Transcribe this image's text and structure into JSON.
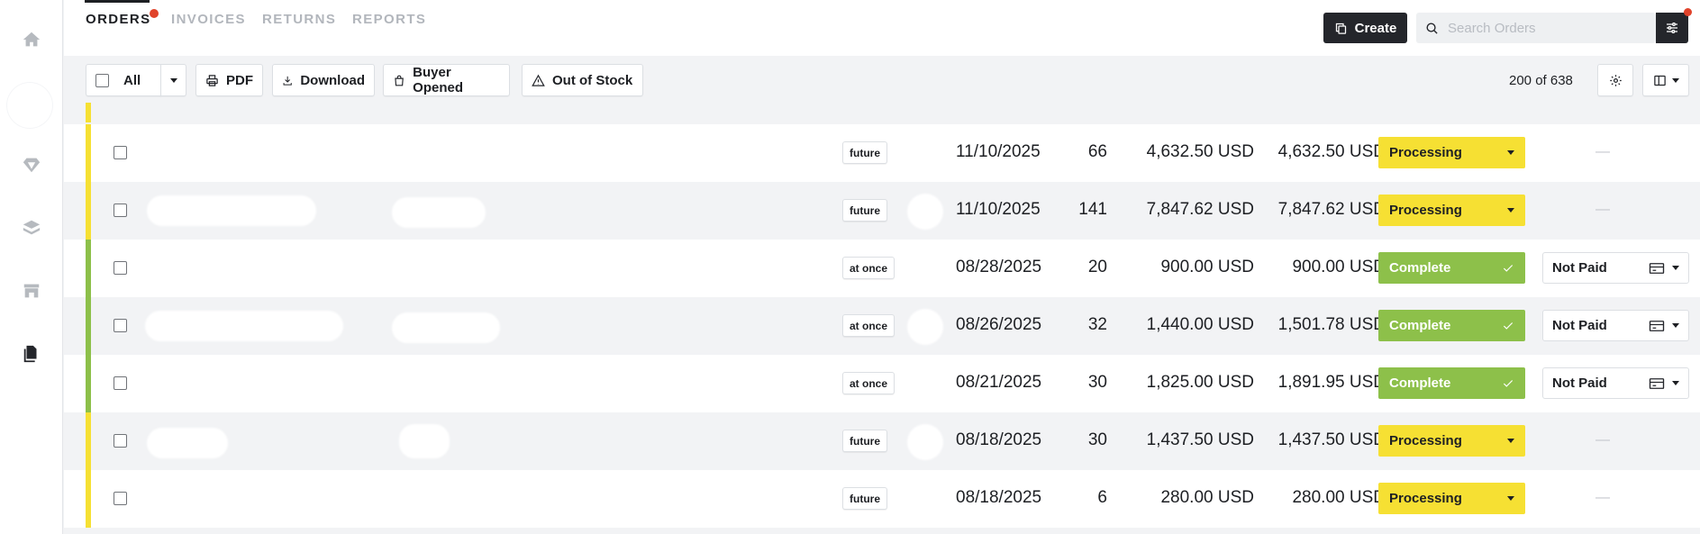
{
  "tabs": [
    {
      "label": "ORDERS",
      "active": true
    },
    {
      "label": "INVOICES",
      "active": false
    },
    {
      "label": "RETURNS",
      "active": false
    },
    {
      "label": "REPORTS",
      "active": false
    }
  ],
  "header": {
    "create_label": "Create",
    "search_placeholder": "Search Orders"
  },
  "toolbar": {
    "all_label": "All",
    "pdf_label": "PDF",
    "download_label": "Download",
    "buyer_opened_label": "Buyer Opened",
    "out_of_stock_label": "Out of Stock",
    "count_text": "200 of 638"
  },
  "colors": {
    "processing": "#f6e033",
    "complete": "#8dc04a",
    "dark": "#24262b",
    "notification": "#e0432b"
  },
  "icons": {
    "sidebar": [
      "home-icon",
      "diamond-icon",
      "layers-icon",
      "store-icon",
      "documents-icon"
    ],
    "header": [
      "copy-icon",
      "search-icon",
      "sliders-icon"
    ],
    "toolbar": [
      "printer-icon",
      "download-icon",
      "bag-icon",
      "warning-icon",
      "gear-icon",
      "columns-icon"
    ],
    "payment": "credit-card-icon",
    "complete_status": "check-icon"
  },
  "orders": [
    {
      "ship": "future",
      "date": "11/10/2025",
      "qty": "66",
      "subtotal": "4,632.50 USD",
      "total": "4,632.50 USD",
      "status": "Processing",
      "payment": "—"
    },
    {
      "ship": "future",
      "date": "11/10/2025",
      "qty": "141",
      "subtotal": "7,847.62 USD",
      "total": "7,847.62 USD",
      "status": "Processing",
      "payment": "—"
    },
    {
      "ship": "at once",
      "date": "08/28/2025",
      "qty": "20",
      "subtotal": "900.00 USD",
      "total": "900.00 USD",
      "status": "Complete",
      "payment": "Not Paid"
    },
    {
      "ship": "at once",
      "date": "08/26/2025",
      "qty": "32",
      "subtotal": "1,440.00 USD",
      "total": "1,501.78 USD",
      "status": "Complete",
      "payment": "Not Paid"
    },
    {
      "ship": "at once",
      "date": "08/21/2025",
      "qty": "30",
      "subtotal": "1,825.00 USD",
      "total": "1,891.95 USD",
      "status": "Complete",
      "payment": "Not Paid"
    },
    {
      "ship": "future",
      "date": "08/18/2025",
      "qty": "30",
      "subtotal": "1,437.50 USD",
      "total": "1,437.50 USD",
      "status": "Processing",
      "payment": "—"
    },
    {
      "ship": "future",
      "date": "08/18/2025",
      "qty": "6",
      "subtotal": "280.00 USD",
      "total": "280.00 USD",
      "status": "Processing",
      "payment": "—"
    }
  ]
}
